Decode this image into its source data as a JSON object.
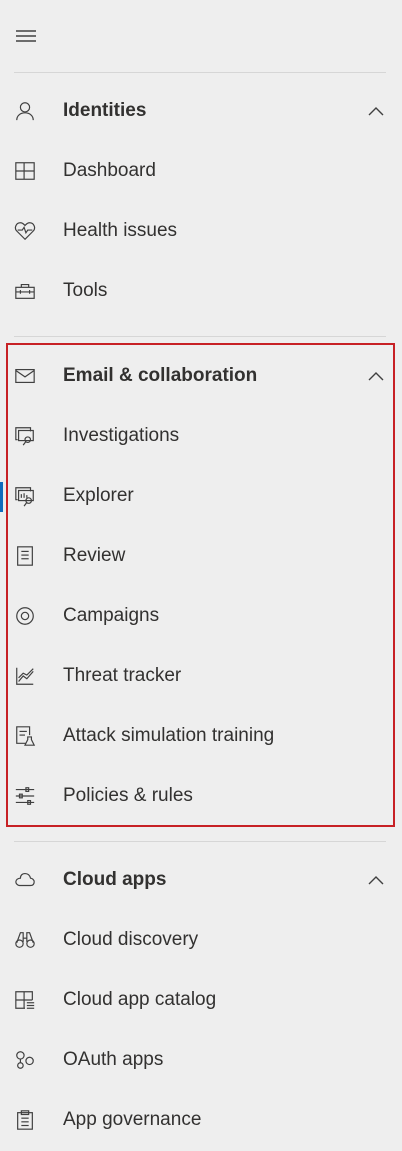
{
  "nav": {
    "menu_icon": "hamburger-icon",
    "sections": [
      {
        "title": "Identities",
        "icon": "person-icon",
        "expanded": true,
        "items": [
          {
            "label": "Dashboard",
            "icon": "dashboard-icon"
          },
          {
            "label": "Health issues",
            "icon": "heart-pulse-icon"
          },
          {
            "label": "Tools",
            "icon": "toolbox-icon"
          }
        ]
      },
      {
        "title": "Email & collaboration",
        "icon": "mail-icon",
        "expanded": true,
        "highlighted": true,
        "items": [
          {
            "label": "Investigations",
            "icon": "investigation-icon"
          },
          {
            "label": "Explorer",
            "icon": "explorer-icon",
            "active": true
          },
          {
            "label": "Review",
            "icon": "review-icon"
          },
          {
            "label": "Campaigns",
            "icon": "target-icon"
          },
          {
            "label": "Threat tracker",
            "icon": "chart-line-icon"
          },
          {
            "label": "Attack simulation training",
            "icon": "simulation-icon"
          },
          {
            "label": "Policies & rules",
            "icon": "sliders-icon"
          }
        ]
      },
      {
        "title": "Cloud apps",
        "icon": "cloud-icon",
        "expanded": true,
        "items": [
          {
            "label": "Cloud discovery",
            "icon": "binoculars-icon"
          },
          {
            "label": "Cloud app catalog",
            "icon": "catalog-icon"
          },
          {
            "label": "OAuth apps",
            "icon": "oauth-icon"
          },
          {
            "label": "App governance",
            "icon": "clipboard-icon"
          }
        ]
      }
    ]
  },
  "colors": {
    "background": "#eeeeee",
    "highlight_border": "#c72125",
    "active_indicator": "#0f6cbd",
    "text": "#323130"
  }
}
